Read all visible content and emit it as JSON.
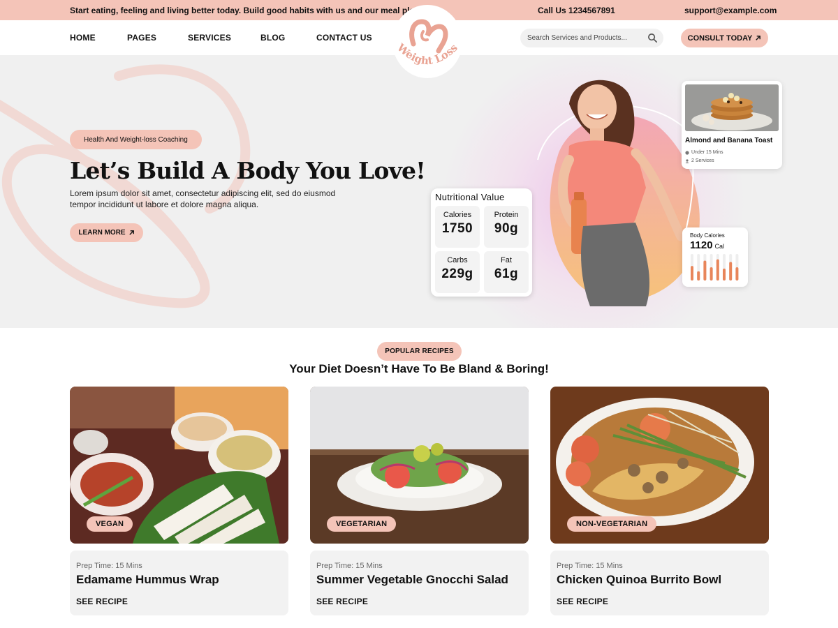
{
  "topbar": {
    "promo": "Start eating, feeling and living better today. Build good habits with us and our meal plans",
    "phone": "Call Us 1234567891",
    "email": "support@example.com"
  },
  "nav": {
    "items": [
      "HOME",
      "PAGES",
      "SERVICES",
      "BLOG",
      "CONTACT US"
    ],
    "search_placeholder": "Search Services and Products...",
    "consult_label": "CONSULT TODAY",
    "logo_text": "Weight Loss"
  },
  "hero": {
    "badge": "Health And Weight-loss Coaching",
    "title": "Let’s Build A Body You Love!",
    "text": "Lorem ipsum dolor sit amet, consectetur adipiscing elit, sed do eiusmod tempor incididunt ut labore et dolore magna aliqua.",
    "button": "LEARN MORE"
  },
  "nutrition": {
    "title": "Nutritional Value",
    "items": [
      {
        "label": "Calories",
        "value": "1750"
      },
      {
        "label": "Protein",
        "value": "90g"
      },
      {
        "label": "Carbs",
        "value": "229g"
      },
      {
        "label": "Fat",
        "value": "61g"
      }
    ]
  },
  "featured": {
    "name": "Almond and Banana Toast",
    "time": "Under 15 Mins",
    "servings": "2 Services"
  },
  "body_calories": {
    "label": "Body Calories",
    "value": "1120",
    "unit": "Cal",
    "bar_levels": [
      0.55,
      0.35,
      0.75,
      0.5,
      0.8,
      0.45,
      0.7,
      0.5
    ]
  },
  "recipes": {
    "badge": "POPULAR RECIPES",
    "title": "Your Diet Doesn’t Have To Be Bland & Boring!",
    "cards": [
      {
        "tag": "VEGAN",
        "prep": "Prep Time: 15 Mins",
        "name": "Edamame Hummus Wrap",
        "link": "SEE RECIPE"
      },
      {
        "tag": "VEGETARIAN",
        "prep": "Prep Time: 15 Mins",
        "name": "Summer Vegetable Gnocchi Salad",
        "link": "SEE RECIPE"
      },
      {
        "tag": "NON-VEGETARIAN",
        "prep": "Prep Time: 15 Mins",
        "name": "Chicken Quinoa Burrito Bowl",
        "link": "SEE RECIPE"
      }
    ]
  },
  "colors": {
    "accent": "#f4c4b8",
    "hero_bg": "#f0f0f0",
    "bar_orange": "#e8855a"
  }
}
